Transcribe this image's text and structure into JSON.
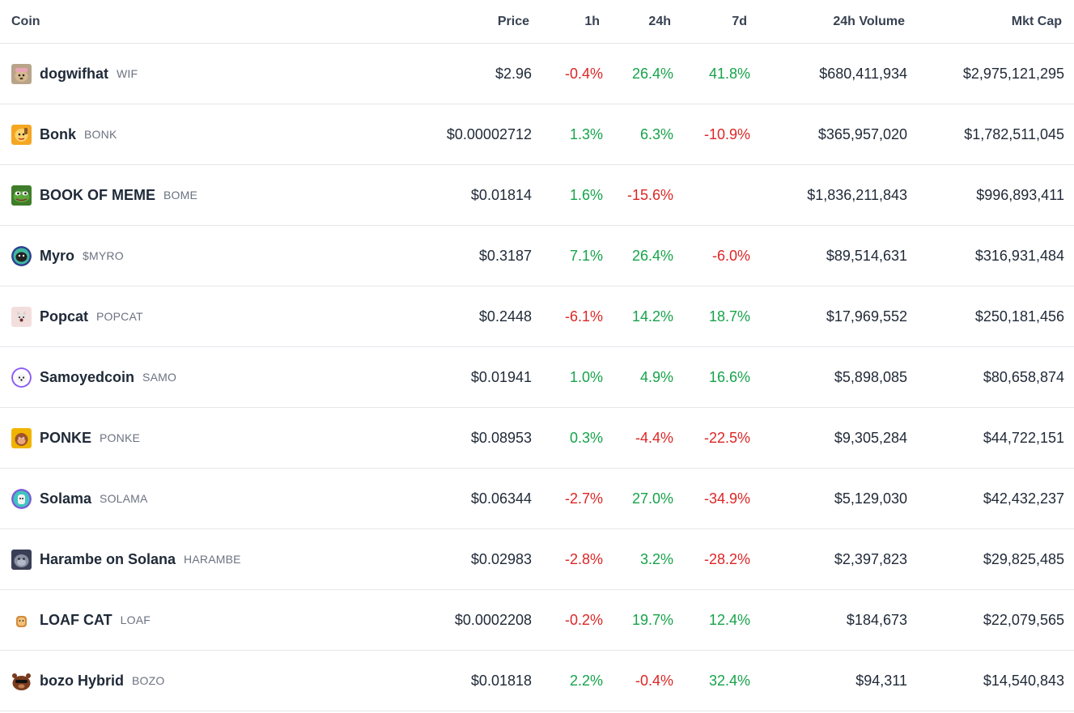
{
  "header": {
    "coin": "Coin",
    "price": "Price",
    "h1": "1h",
    "h24": "24h",
    "d7": "7d",
    "volume": "24h Volume",
    "mcap": "Mkt Cap"
  },
  "colors": {
    "positive": "#16a34a",
    "negative": "#dc2626",
    "text": "#1f2937",
    "muted": "#6b7280",
    "border": "#e5e7eb"
  },
  "rows": [
    {
      "name": "dogwifhat",
      "symbol": "WIF",
      "icon": "dog-hat-icon",
      "price": "$2.96",
      "h1": "-0.4%",
      "h24": "26.4%",
      "d7": "41.8%",
      "volume": "$680,411,934",
      "mcap": "$2,975,121,295"
    },
    {
      "name": "Bonk",
      "symbol": "BONK",
      "icon": "bonk-dog-icon",
      "price": "$0.00002712",
      "h1": "1.3%",
      "h24": "6.3%",
      "d7": "-10.9%",
      "volume": "$365,957,020",
      "mcap": "$1,782,511,045"
    },
    {
      "name": "BOOK OF MEME",
      "symbol": "BOME",
      "icon": "pepe-frog-icon",
      "price": "$0.01814",
      "h1": "1.6%",
      "h24": "-15.6%",
      "d7": "",
      "volume": "$1,836,211,843",
      "mcap": "$996,893,411"
    },
    {
      "name": "Myro",
      "symbol": "$MYRO",
      "icon": "myro-dog-icon",
      "price": "$0.3187",
      "h1": "7.1%",
      "h24": "26.4%",
      "d7": "-6.0%",
      "volume": "$89,514,631",
      "mcap": "$316,931,484"
    },
    {
      "name": "Popcat",
      "symbol": "POPCAT",
      "icon": "popcat-icon",
      "price": "$0.2448",
      "h1": "-6.1%",
      "h24": "14.2%",
      "d7": "18.7%",
      "volume": "$17,969,552",
      "mcap": "$250,181,456"
    },
    {
      "name": "Samoyedcoin",
      "symbol": "SAMO",
      "icon": "samoyed-icon",
      "price": "$0.01941",
      "h1": "1.0%",
      "h24": "4.9%",
      "d7": "16.6%",
      "volume": "$5,898,085",
      "mcap": "$80,658,874"
    },
    {
      "name": "PONKE",
      "symbol": "PONKE",
      "icon": "ponke-monkey-icon",
      "price": "$0.08953",
      "h1": "0.3%",
      "h24": "-4.4%",
      "d7": "-22.5%",
      "volume": "$9,305,284",
      "mcap": "$44,722,151"
    },
    {
      "name": "Solama",
      "symbol": "SOLAMA",
      "icon": "solama-llama-icon",
      "price": "$0.06344",
      "h1": "-2.7%",
      "h24": "27.0%",
      "d7": "-34.9%",
      "volume": "$5,129,030",
      "mcap": "$42,432,237"
    },
    {
      "name": "Harambe on Solana",
      "symbol": "HARAMBE",
      "icon": "harambe-gorilla-icon",
      "price": "$0.02983",
      "h1": "-2.8%",
      "h24": "3.2%",
      "d7": "-28.2%",
      "volume": "$2,397,823",
      "mcap": "$29,825,485"
    },
    {
      "name": "LOAF CAT",
      "symbol": "LOAF",
      "icon": "bread-loaf-icon",
      "price": "$0.0002208",
      "h1": "-0.2%",
      "h24": "19.7%",
      "d7": "12.4%",
      "volume": "$184,673",
      "mcap": "$22,079,565"
    },
    {
      "name": "bozo Hybrid",
      "symbol": "BOZO",
      "icon": "bozo-bear-icon",
      "price": "$0.01818",
      "h1": "2.2%",
      "h24": "-0.4%",
      "d7": "32.4%",
      "volume": "$94,311",
      "mcap": "$14,540,843"
    }
  ]
}
